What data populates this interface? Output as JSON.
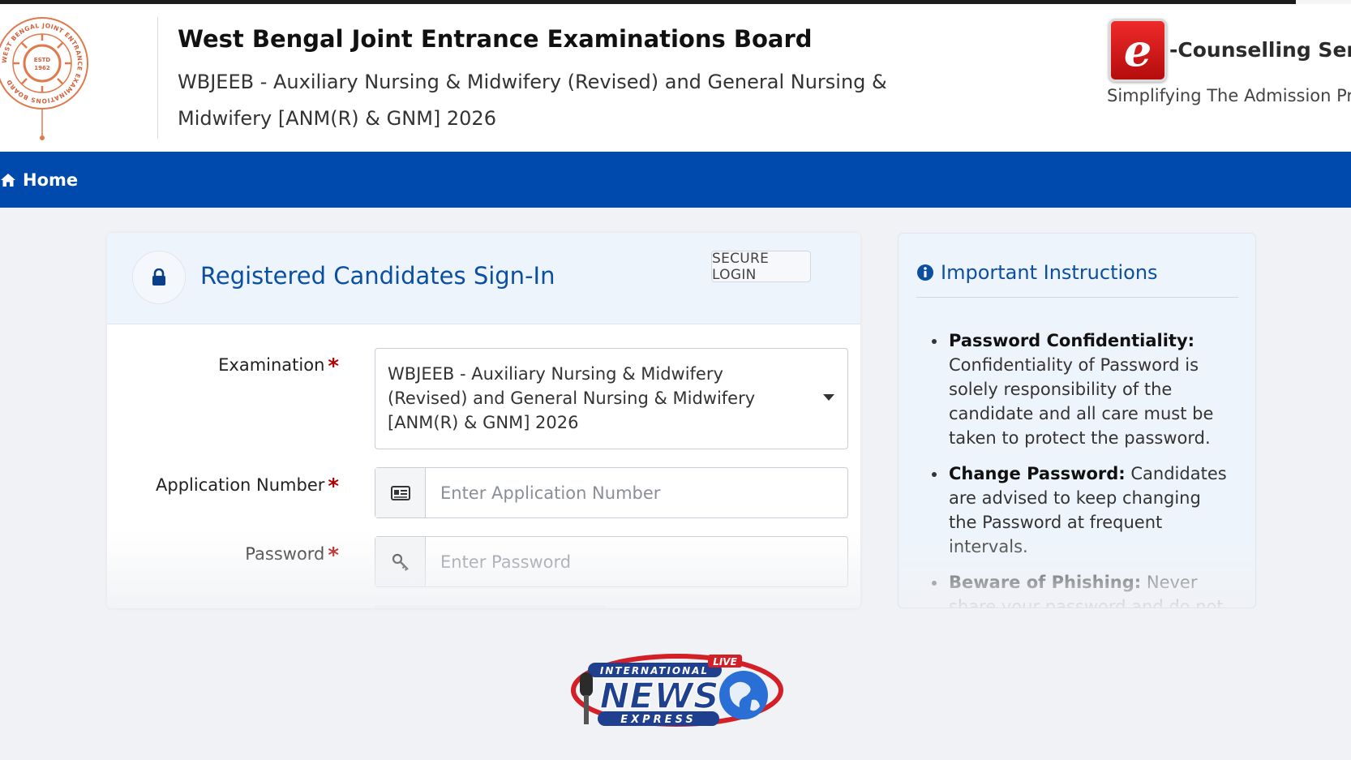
{
  "header": {
    "title": "West Bengal Joint Entrance Examinations Board",
    "subtitle": "WBJEEB - Auxiliary Nursing & Midwifery (Revised) and General Nursing & Midwifery [ANM(R) & GNM] 2026",
    "emblem": {
      "ring_text": "WEST BENGAL JOINT ENTRANCE EXAMINATIONS BOARD",
      "estd": "ESTD",
      "year": "1962"
    },
    "ecounselling": {
      "logo_letter": "e",
      "label": "-Counselling Service",
      "tagline": "Simplifying The Admission Proc"
    }
  },
  "nav": {
    "home_label": "Home",
    "home_icon": "home-icon"
  },
  "login": {
    "title": "Registered Candidates Sign-In",
    "badge": "SECURE LOGIN",
    "examination_label": "Examination",
    "examination_value": "WBJEEB - Auxiliary Nursing & Midwifery (Revised) and General Nursing & Midwifery [ANM(R) & GNM] 2026",
    "application_label": "Application Number",
    "application_placeholder": "Enter Application Number",
    "password_label": "Password",
    "password_placeholder": "Enter Password",
    "required_mark": "*"
  },
  "instructions": {
    "title": "Important Instructions",
    "items": [
      {
        "heading": "Password Confidentiality:",
        "text": "Confidentiality of Password is solely responsibility of the candidate and all care must be taken to protect the password."
      },
      {
        "heading": "Change Password:",
        "text": "Candidates are advised to keep changing the Password at frequent intervals."
      },
      {
        "heading": "Beware of Phishing:",
        "text": "Never share your password and do not respond to any mail which asks"
      }
    ]
  },
  "watermark": {
    "top": "INTERNATIONAL",
    "main": "NEWS",
    "bottom": "EXPRESS",
    "live": "LIVE"
  },
  "colors": {
    "nav_blue": "#004aad",
    "title_blue": "#0b4fa0",
    "required_red": "#b10000",
    "brand_red": "#d81b1b"
  }
}
